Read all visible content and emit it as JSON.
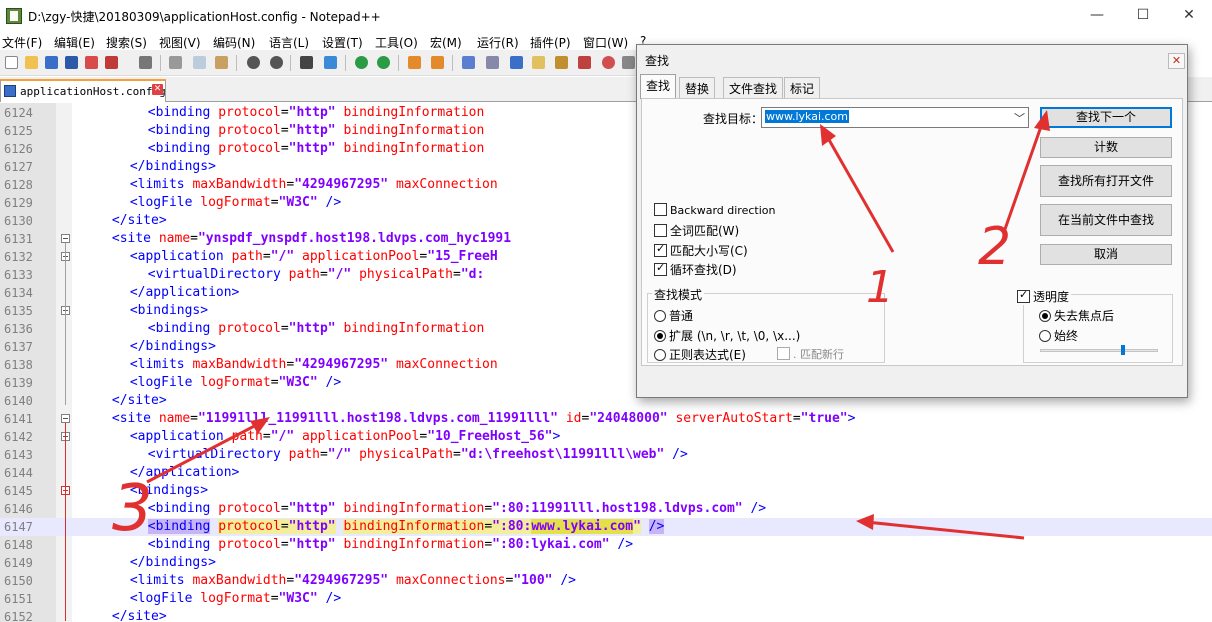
{
  "window": {
    "title": "D:\\zgy-快捷\\20180309\\applicationHost.config - Notepad++",
    "minimize_glyph": "—",
    "maximize_glyph": "☐",
    "close_glyph": "✕"
  },
  "menu": [
    "文件(F)",
    "编辑(E)",
    "搜索(S)",
    "视图(V)",
    "编码(N)",
    "语言(L)",
    "设置(T)",
    "工具(O)",
    "宏(M)",
    "运行(R)",
    "插件(P)",
    "窗口(W)",
    "?"
  ],
  "toolbar_icons": [
    "new-file-icon",
    "open-file-icon",
    "save-icon",
    "save-all-icon",
    "close-icon",
    "close-all-icon",
    "print-icon",
    "cut-icon",
    "copy-icon",
    "paste-icon",
    "undo-icon",
    "redo-icon",
    "find-icon",
    "replace-icon",
    "zoom-in-icon",
    "zoom-out-icon",
    "sync-v-icon",
    "sync-h-icon",
    "word-wrap-icon",
    "show-all-chars-icon",
    "indent-guide-icon",
    "doc-map-icon",
    "function-list-icon",
    "folder-workspace-icon",
    "monitor-icon",
    "record-macro-icon"
  ],
  "tab": {
    "label": "applicationHost.config",
    "close_glyph": "✕"
  },
  "editor": {
    "current_line": 6147,
    "lines": [
      {
        "n": "6124",
        "indent": 8,
        "html": "<span class=\"tg\">&lt;binding</span> <span class=\"at\">protocol</span><span class=\"tx\">=</span><span class=\"vl\">\"http\"</span> <span class=\"at\">bindingInformation</span>"
      },
      {
        "n": "6125",
        "indent": 8,
        "html": "<span class=\"tg\">&lt;binding</span> <span class=\"at\">protocol</span><span class=\"tx\">=</span><span class=\"vl\">\"http\"</span> <span class=\"at\">bindingInformation</span>"
      },
      {
        "n": "6126",
        "indent": 8,
        "html": "<span class=\"tg\">&lt;binding</span> <span class=\"at\">protocol</span><span class=\"tx\">=</span><span class=\"vl\">\"http\"</span> <span class=\"at\">bindingInformation</span>"
      },
      {
        "n": "6127",
        "indent": 6,
        "html": "<span class=\"tg\">&lt;/bindings&gt;</span>"
      },
      {
        "n": "6128",
        "indent": 6,
        "html": "<span class=\"tg\">&lt;limits</span> <span class=\"at\">maxBandwidth</span><span class=\"tx\">=</span><span class=\"vl\">\"4294967295\"</span> <span class=\"at\">maxConnection</span>"
      },
      {
        "n": "6129",
        "indent": 6,
        "html": "<span class=\"tg\">&lt;logFile</span> <span class=\"at\">logFormat</span><span class=\"tx\">=</span><span class=\"vl\">\"W3C\"</span> <span class=\"tg\">/&gt;</span>"
      },
      {
        "n": "6130",
        "indent": 4,
        "html": "<span class=\"tg\">&lt;/site&gt;</span>"
      },
      {
        "n": "6131",
        "indent": 4,
        "html": "<span class=\"tg\">&lt;site</span> <span class=\"at\">name</span><span class=\"tx\">=</span><span class=\"vl\">\"ynspdf_ynspdf.host198.ldvps.com_hyc1991</span>"
      },
      {
        "n": "6132",
        "indent": 6,
        "html": "<span class=\"tg\">&lt;application</span> <span class=\"at\">path</span><span class=\"tx\">=</span><span class=\"vl\">\"/\"</span> <span class=\"at\">applicationPool</span><span class=\"tx\">=</span><span class=\"vl\">\"15_FreeH</span>"
      },
      {
        "n": "6133",
        "indent": 8,
        "html": "<span class=\"tg\">&lt;virtualDirectory</span> <span class=\"at\">path</span><span class=\"tx\">=</span><span class=\"vl\">\"/\"</span> <span class=\"at\">physicalPath</span><span class=\"tx\">=</span><span class=\"vl\">\"d:</span>"
      },
      {
        "n": "6134",
        "indent": 6,
        "html": "<span class=\"tg\">&lt;/application&gt;</span>"
      },
      {
        "n": "6135",
        "indent": 6,
        "html": "<span class=\"tg\">&lt;bindings&gt;</span>"
      },
      {
        "n": "6136",
        "indent": 8,
        "html": "<span class=\"tg\">&lt;binding</span> <span class=\"at\">protocol</span><span class=\"tx\">=</span><span class=\"vl\">\"http\"</span> <span class=\"at\">bindingInformation</span>"
      },
      {
        "n": "6137",
        "indent": 6,
        "html": "<span class=\"tg\">&lt;/bindings&gt;</span>"
      },
      {
        "n": "6138",
        "indent": 6,
        "html": "<span class=\"tg\">&lt;limits</span> <span class=\"at\">maxBandwidth</span><span class=\"tx\">=</span><span class=\"vl\">\"4294967295\"</span> <span class=\"at\">maxConnection</span>"
      },
      {
        "n": "6139",
        "indent": 6,
        "html": "<span class=\"tg\">&lt;logFile</span> <span class=\"at\">logFormat</span><span class=\"tx\">=</span><span class=\"vl\">\"W3C\"</span> <span class=\"tg\">/&gt;</span>"
      },
      {
        "n": "6140",
        "indent": 4,
        "html": "<span class=\"tg\">&lt;/site&gt;</span>"
      },
      {
        "n": "6141",
        "indent": 4,
        "html": "<span class=\"tg\">&lt;site</span> <span class=\"at\">name</span><span class=\"tx\">=</span><span class=\"vl\">\"11991lll_11991lll.host198.ldvps.com_11991lll\"</span> <span class=\"at\">id</span><span class=\"tx\">=</span><span class=\"vl\">\"24048000\"</span> <span class=\"at\">serverAutoStart</span><span class=\"tx\">=</span><span class=\"vl\">\"true\"</span><span class=\"tg\">&gt;</span>"
      },
      {
        "n": "6142",
        "indent": 6,
        "html": "<span class=\"tg\">&lt;application</span> <span class=\"at\">path</span><span class=\"tx\">=</span><span class=\"vl\">\"/\"</span> <span class=\"at\">applicationPool</span><span class=\"tx\">=</span><span class=\"vl\">\"10_FreeHost_56\"</span><span class=\"tg\">&gt;</span>"
      },
      {
        "n": "6143",
        "indent": 8,
        "html": "<span class=\"tg\">&lt;virtualDirectory</span> <span class=\"at\">path</span><span class=\"tx\">=</span><span class=\"vl\">\"/\"</span> <span class=\"at\">physicalPath</span><span class=\"tx\">=</span><span class=\"vl\">\"d:\\freehost\\11991lll\\web\"</span> <span class=\"tg\">/&gt;</span>"
      },
      {
        "n": "6144",
        "indent": 6,
        "html": "<span class=\"tg\">&lt;/application&gt;</span>"
      },
      {
        "n": "6145",
        "indent": 6,
        "html": "<span class=\"tg\">&lt;bindings&gt;</span>"
      },
      {
        "n": "6146",
        "indent": 8,
        "html": "<span class=\"tg\">&lt;binding</span> <span class=\"at\">protocol</span><span class=\"tx\">=</span><span class=\"vl\">\"http\"</span> <span class=\"at\">bindingInformation</span><span class=\"tx\">=</span><span class=\"vl\">\":80:11991lll.host198.ldvps.com\"</span> <span class=\"tg\">/&gt;</span>"
      },
      {
        "n": "6147",
        "indent": 8,
        "html": "<span class=\"tg hl-purple\">&lt;binding</span> <span class=\"at hl-yellow\">protocol</span><span class=\"tx hl-yellow\">=</span><span class=\"vl hl-yellow\">\"http\"</span> <span class=\"at hl-yellow\">bindingInformation</span><span class=\"tx hl-yellow\">=</span><span class=\"vl hl-yellow\">\":80:</span><span class=\"vl hl-yellow\" style=\"background:#e4e04a\">www.lykai.com</span><span class=\"vl hl-yellow\">\"</span> <span class=\"tg hl-purple\">/&gt;</span>"
      },
      {
        "n": "6148",
        "indent": 8,
        "html": "<span class=\"tg\">&lt;binding</span> <span class=\"at\">protocol</span><span class=\"tx\">=</span><span class=\"vl\">\"http\"</span> <span class=\"at\">bindingInformation</span><span class=\"tx\">=</span><span class=\"vl\">\":80:lykai.com\"</span> <span class=\"tg\">/&gt;</span>"
      },
      {
        "n": "6149",
        "indent": 6,
        "html": "<span class=\"tg\">&lt;/bindings&gt;</span>"
      },
      {
        "n": "6150",
        "indent": 6,
        "html": "<span class=\"tg\">&lt;limits</span> <span class=\"at\">maxBandwidth</span><span class=\"tx\">=</span><span class=\"vl\">\"4294967295\"</span> <span class=\"at\">maxConnections</span><span class=\"tx\">=</span><span class=\"vl\">\"100\"</span> <span class=\"tg\">/&gt;</span>"
      },
      {
        "n": "6151",
        "indent": 6,
        "html": "<span class=\"tg\">&lt;logFile</span> <span class=\"at\">logFormat</span><span class=\"tx\">=</span><span class=\"vl\">\"W3C\"</span> <span class=\"tg\">/&gt;</span>"
      },
      {
        "n": "6152",
        "indent": 4,
        "html": "<span class=\"tg\">&lt;/site&gt;</span>"
      }
    ]
  },
  "find_dialog": {
    "title": "查找",
    "close_glyph": "✕",
    "tabs": [
      "查找",
      "替换",
      "文件查找",
      "标记"
    ],
    "find_label": "查找目标：",
    "find_value": "www.lykai.com",
    "dropdown_glyph": "﹀",
    "buttons": {
      "find_next": "查找下一个",
      "count": "计数",
      "find_all_open": "查找所有打开文件",
      "find_all_current": "在当前文件中查找",
      "cancel": "取消"
    },
    "options": {
      "backward": "Backward direction",
      "whole_word": "全词匹配(W)",
      "match_case": "匹配大小写(C)",
      "wrap": "循环查找(D)"
    },
    "search_mode": {
      "title": "查找模式",
      "normal": "普通",
      "extended": "扩展 (\\n, \\r, \\t, \\0, \\x...)",
      "regex": "正则表达式(E)",
      "dot_newline": ". 匹配新行"
    },
    "transparency": {
      "title": "透明度",
      "on_lose_focus": "失去焦点后",
      "always": "始终"
    }
  },
  "annotations": [
    "1",
    "2",
    "3"
  ],
  "colors": {
    "tag": "#0000ff",
    "attribute": "#ff0000",
    "value": "#8000ff",
    "annotation_red": "#e03030",
    "accent": "#0078d7"
  }
}
